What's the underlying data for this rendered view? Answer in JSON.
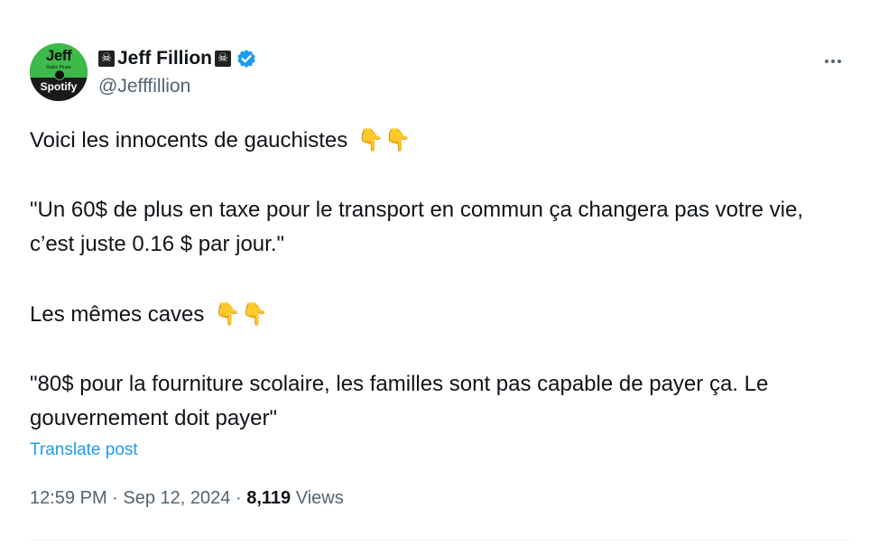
{
  "author": {
    "name": "Jeff Fillion",
    "handle": "@Jefffillion",
    "avatar_text_top": "Jeff",
    "avatar_text_bottom": "Spotify",
    "avatar_text_small": "Radio Pirate",
    "name_emoji": "☠",
    "verified_color": "#1d9bf0"
  },
  "tweet": {
    "line1": "Voici les innocents de gauchistes",
    "line2": "\"Un 60$ de plus en taxe pour le transport en commun ça changera pas votre vie, c’est juste 0.16 $ par jour.\"",
    "line3": "Les mêmes caves",
    "line4": "\"80$ pour la fourniture scolaire, les familles sont pas capable de payer ça. Le gouvernement doit payer\"",
    "emoji": "👇👇",
    "emoji_name": "backhand-index-pointing-down"
  },
  "translate_label": "Translate post",
  "meta": {
    "time": "12:59 PM",
    "separator": "·",
    "date": "Sep 12, 2024",
    "views_count": "8,119",
    "views_label": "Views"
  },
  "colors": {
    "text": "#0f1419",
    "secondary": "#536471",
    "link": "#1d9bf0",
    "emoji": "#f7c948"
  }
}
